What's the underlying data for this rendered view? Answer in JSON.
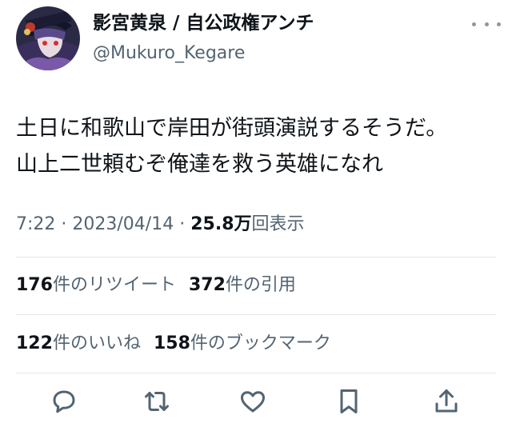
{
  "tweet": {
    "display_name": "影宮黄泉 / 自公政権アンチ",
    "handle": "@Mukuro_Kegare",
    "text_lines": [
      "土日に和歌山で岸田が街頭演説するそうだ。",
      "山上二世頼むぞ俺達を救う英雄になれ"
    ],
    "time": "7:22",
    "sep": "·",
    "date": "2023/04/14",
    "views_count": "25.8万",
    "views_label": "回表示"
  },
  "stats": {
    "retweets_count": "176",
    "retweets_label": "件のリツイート",
    "quotes_count": "372",
    "quotes_label": "件の引用",
    "likes_count": "122",
    "likes_label": "件のいいね",
    "bookmarks_count": "158",
    "bookmarks_label": "件のブックマーク"
  },
  "icons": {
    "more": "more-dots-icon",
    "reply": "reply-icon",
    "retweet": "retweet-icon",
    "like": "heart-icon",
    "bookmark": "bookmark-icon",
    "share": "share-icon"
  },
  "colors": {
    "text": "#0f1419",
    "secondary": "#536471",
    "divider": "#e1e6ea"
  }
}
